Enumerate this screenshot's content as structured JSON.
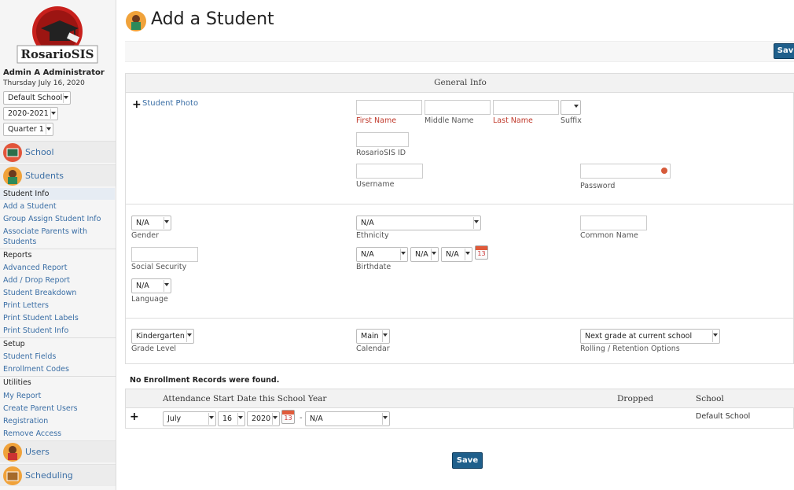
{
  "sidebar": {
    "logo_text": "RosarioSIS",
    "user_name": "Admin A Administrator",
    "date": "Thursday July 16, 2020",
    "school_select": "Default School",
    "year_select": "2020-2021",
    "quarter_select": "Quarter 1",
    "menu_school": "School",
    "menu_students": "Students",
    "items": [
      "Student Info",
      "Add a Student",
      "Group Assign Student Info",
      "Associate Parents with",
      "Students",
      "Reports",
      "Advanced Report",
      "Add / Drop Report",
      "Student Breakdown",
      "Print Letters",
      "Print Student Labels",
      "Print Student Info",
      "Setup",
      "Student Fields",
      "Enrollment Codes",
      "Utilities",
      "My Report",
      "Create Parent Users",
      "Registration",
      "Remove Access"
    ],
    "menu_users": "Users",
    "menu_scheduling": "Scheduling"
  },
  "main": {
    "title": "Add a Student",
    "save_top": "Sav",
    "save_bottom": "Save"
  },
  "general": {
    "header": "General Info",
    "student_photo": "Student Photo",
    "first_name": "First Name",
    "middle_name": "Middle Name",
    "last_name": "Last Name",
    "suffix": "Suffix",
    "rosario_id": "RosarioSIS ID",
    "username": "Username",
    "password": "Password",
    "gender_value": "N/A",
    "gender": "Gender",
    "ethnicity_value": "N/A",
    "ethnicity": "Ethnicity",
    "common_name": "Common Name",
    "social_security": "Social Security",
    "birth_month": "N/A",
    "birth_day": "N/A",
    "birth_year": "N/A",
    "birthdate": "Birthdate",
    "language_value": "N/A",
    "language": "Language",
    "grade_value": "Kindergarten",
    "grade_level": "Grade Level",
    "calendar_value": "Main",
    "calendar": "Calendar",
    "rolling_value": "Next grade at current school",
    "rolling": "Rolling / Retention Options"
  },
  "enrollment": {
    "none_found": "No Enrollment Records were found.",
    "col_start": "Attendance Start Date this School Year",
    "col_dropped": "Dropped",
    "col_school": "School",
    "month": "July",
    "day": "16",
    "year": "2020",
    "dash": "-",
    "drop_code": "N/A",
    "school": "Default School",
    "calendar_icon_num": "13"
  },
  "colors": {
    "accent": "#3a6ea5",
    "required": "#c0392b",
    "button": "#1f5f8b"
  }
}
